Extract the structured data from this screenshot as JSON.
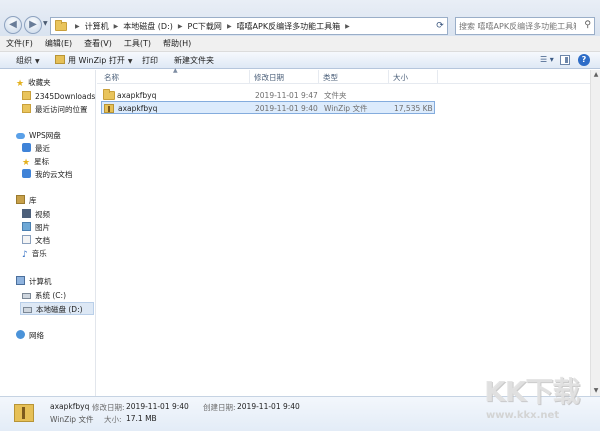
{
  "address": {
    "crumbs": [
      "计算机",
      "本地磁盘 (D:)",
      "PC下载网",
      "嘻嘻APK反编译多功能工具箱"
    ],
    "search_placeholder": "搜索 嘻嘻APK反编译多功能工具箱"
  },
  "menu": [
    "文件(F)",
    "编辑(E)",
    "查看(V)",
    "工具(T)",
    "帮助(H)"
  ],
  "toolbar": {
    "organize": "组织",
    "open_with": "用 WinZip 打开",
    "print": "打印",
    "new_folder": "新建文件夹"
  },
  "nav": {
    "favorites": "收藏夹",
    "fav_items": [
      "2345Downloads",
      "最近访问的位置"
    ],
    "wps": "WPS网盘",
    "wps_items": [
      "最近",
      "星标",
      "我的云文档"
    ],
    "library": "库",
    "lib_items": [
      "视频",
      "图片",
      "文档",
      "音乐"
    ],
    "computer": "计算机",
    "drives": [
      "系统 (C:)",
      "本地磁盘 (D:)"
    ],
    "network": "网络"
  },
  "columns": [
    "名称",
    "修改日期",
    "类型",
    "大小"
  ],
  "files": [
    {
      "name": "axapkfbyq",
      "date": "2019-11-01 9:47",
      "type": "文件夹",
      "size": "",
      "icon": "folder-icon"
    },
    {
      "name": "axapkfbyq",
      "date": "2019-11-01 9:40",
      "type": "WinZip 文件",
      "size": "17,535 KB",
      "icon": "winzip-icon"
    }
  ],
  "details": {
    "name": "axapkfbyq",
    "type": "WinZip 文件",
    "modified_label": "修改日期:",
    "modified": "2019-11-01 9:40",
    "created_label": "创建日期:",
    "created": "2019-11-01 9:40",
    "size_label": "大小:",
    "size": "17.1 MB"
  },
  "watermark": {
    "big": "KK下载",
    "small": "www.kkx.net"
  }
}
